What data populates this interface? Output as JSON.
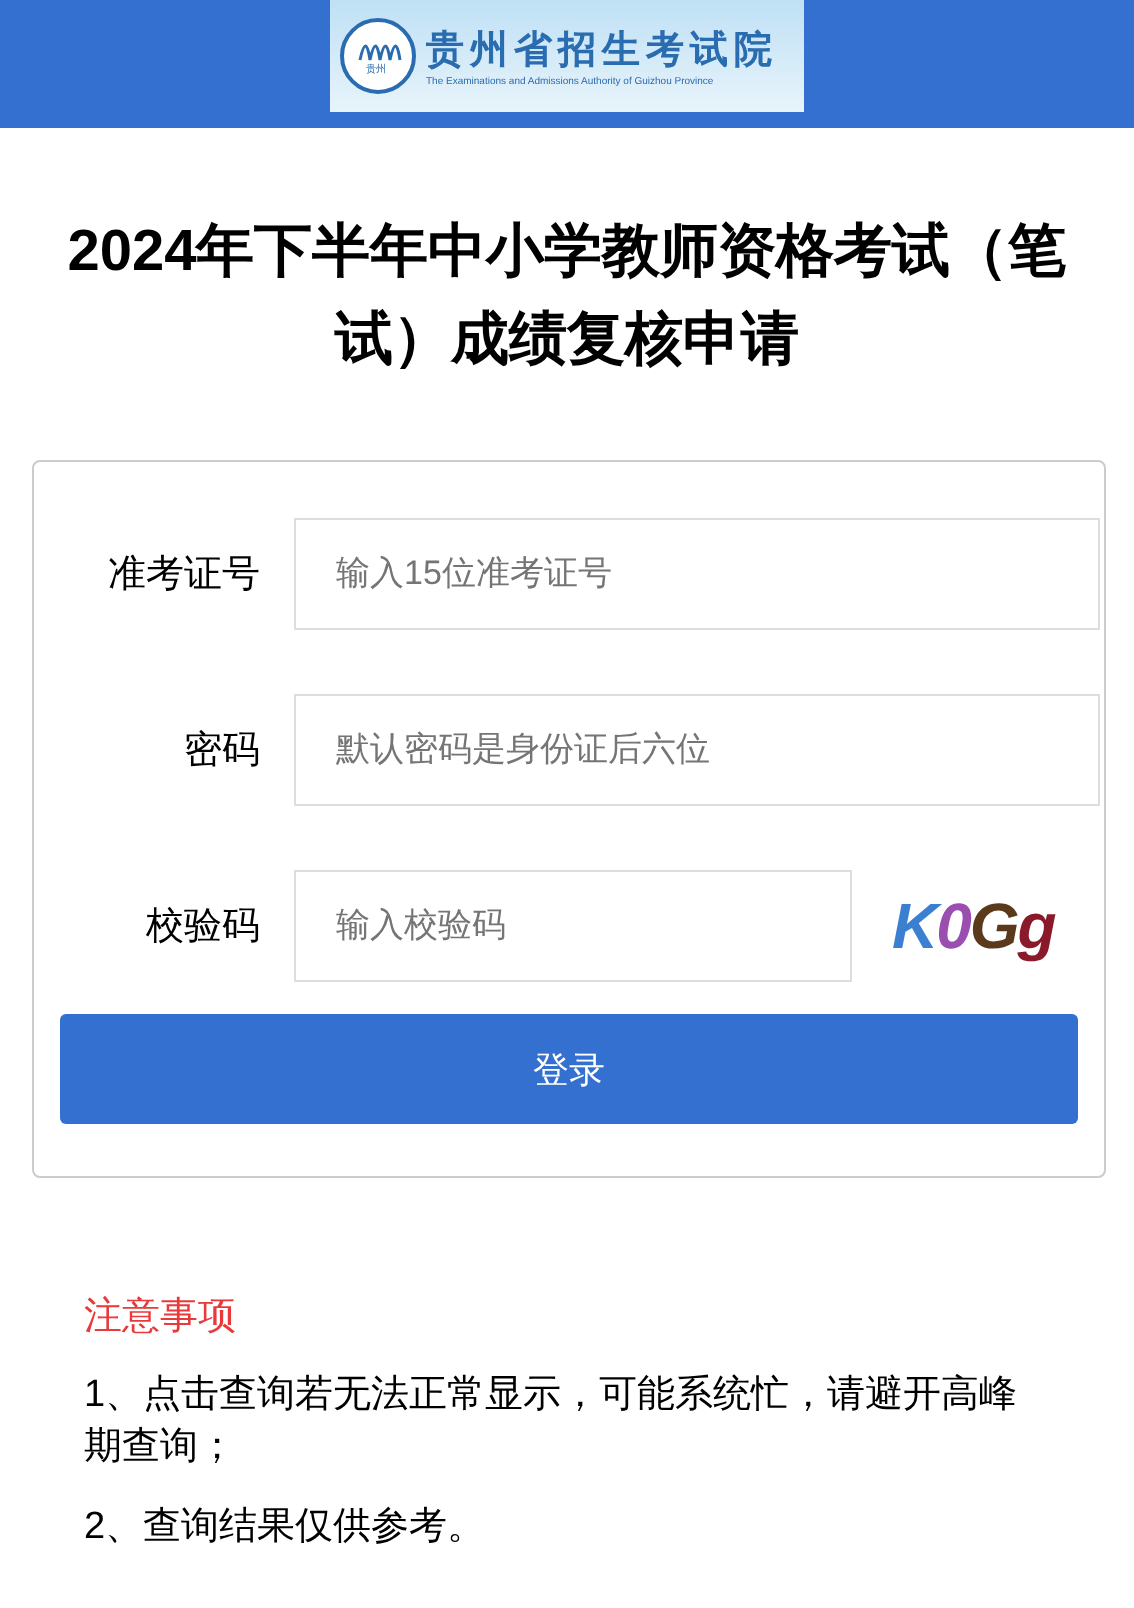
{
  "header": {
    "logo_title": "贵州省招生考试院",
    "logo_subtitle": "The Examinations and Admissions Authority of Guizhou Province",
    "logo_mark": "贵州"
  },
  "title": "2024年下半年中小学教师资格考试（笔试）成绩复核申请",
  "form": {
    "fields": [
      {
        "label": "准考证号",
        "placeholder": "输入15位准考证号",
        "kind": "text"
      },
      {
        "label": "密码",
        "placeholder": "默认密码是身份证后六位",
        "kind": "text"
      },
      {
        "label": "校验码",
        "placeholder": "输入校验码",
        "kind": "captcha",
        "captcha": "K0Gg"
      }
    ],
    "submit": "登录"
  },
  "notice": {
    "title": "注意事项",
    "items": [
      "1、点击查询若无法正常显示，可能系统忙，请避开高峰期查询；",
      "2、查询结果仅供参考。"
    ]
  }
}
